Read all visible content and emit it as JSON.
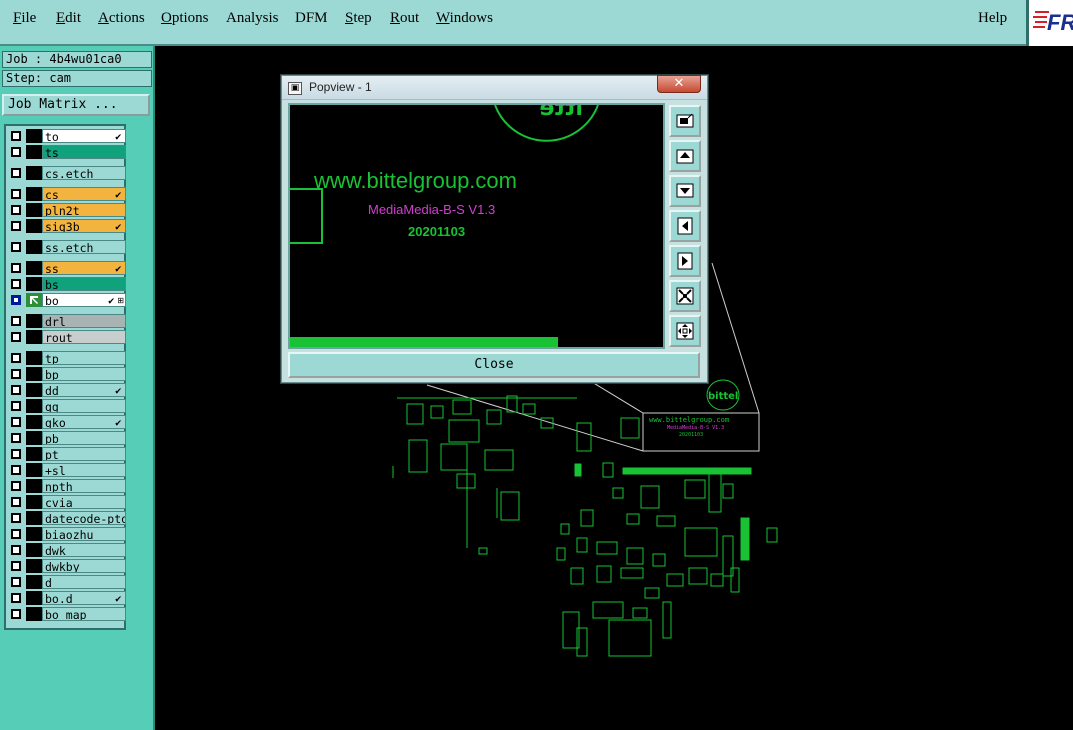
{
  "menubar": {
    "items": [
      {
        "pre": "",
        "u": "F",
        "post": "ile"
      },
      {
        "pre": "",
        "u": "E",
        "post": "dit"
      },
      {
        "pre": "",
        "u": "A",
        "post": "ctions"
      },
      {
        "pre": "",
        "u": "O",
        "post": "ptions"
      },
      {
        "pre": "",
        "u": "",
        "post": "Analysis"
      },
      {
        "pre": "",
        "u": "",
        "post": "DFM"
      },
      {
        "pre": "",
        "u": "S",
        "post": "tep"
      },
      {
        "pre": "",
        "u": "R",
        "post": "out"
      },
      {
        "pre": "",
        "u": "W",
        "post": "indows"
      }
    ],
    "help": "Help",
    "logo_text": "FR"
  },
  "job": {
    "job_line": "Job : 4b4wu01ca0",
    "step_line": "Step: cam",
    "matrix_button": "Job Matrix ..."
  },
  "layers": [
    {
      "name": "to",
      "color": "white",
      "mark": "✔"
    },
    {
      "name": "ts",
      "color": "green",
      "mark": ""
    },
    {
      "name": "cs.etch",
      "color": "default",
      "mark": ""
    },
    {
      "name": "cs",
      "color": "orange",
      "mark": "✔"
    },
    {
      "name": "pln2t",
      "color": "orange",
      "mark": ""
    },
    {
      "name": "sig3b",
      "color": "orange",
      "mark": "✔"
    },
    {
      "name": "ss.etch",
      "color": "default",
      "mark": ""
    },
    {
      "name": "ss",
      "color": "orange",
      "mark": "✔"
    },
    {
      "name": "bs",
      "color": "green",
      "mark": ""
    },
    {
      "name": "bo",
      "color": "white",
      "mark": "✔"
    },
    {
      "name": "drl",
      "color": "grey",
      "mark": ""
    },
    {
      "name": "rout",
      "color": "lightgrey",
      "mark": ""
    },
    {
      "name": "tp",
      "color": "default",
      "mark": ""
    },
    {
      "name": "bp",
      "color": "default",
      "mark": ""
    },
    {
      "name": "dd",
      "color": "default",
      "mark": "✔"
    },
    {
      "name": "gg",
      "color": "default",
      "mark": ""
    },
    {
      "name": "gko",
      "color": "default",
      "mark": "✔"
    },
    {
      "name": "pb",
      "color": "default",
      "mark": ""
    },
    {
      "name": "pt",
      "color": "default",
      "mark": ""
    },
    {
      "name": "+sl",
      "color": "default",
      "mark": ""
    },
    {
      "name": "npth",
      "color": "default",
      "mark": ""
    },
    {
      "name": "cvia",
      "color": "default",
      "mark": ""
    },
    {
      "name": "datecode-pto",
      "color": "default",
      "mark": ""
    },
    {
      "name": "biaozhu",
      "color": "default",
      "mark": ""
    },
    {
      "name": "dwk",
      "color": "default",
      "mark": ""
    },
    {
      "name": "dwkby",
      "color": "default",
      "mark": ""
    },
    {
      "name": "d",
      "color": "default",
      "mark": ""
    },
    {
      "name": "bo.d",
      "color": "default",
      "mark": "✔"
    },
    {
      "name": "bo_map",
      "color": "default",
      "mark": ""
    }
  ],
  "popview": {
    "title": "Popview - 1",
    "close_x": "✕",
    "close_button": "Close",
    "silk_url": "www.bittelgroup.com",
    "silk_model": "MediaMedia-B-S  V1.3",
    "silk_date": "20201103",
    "board_logo": "bittel",
    "tools": [
      "zoom-fit-icon",
      "move-up-icon",
      "move-down-icon",
      "move-left-icon",
      "move-right-icon",
      "zoom-out-icon",
      "pan-icon"
    ]
  },
  "colors": {
    "panel": "#9cd9d5",
    "left_bg": "#56cdb6",
    "silk_green": "#18c234",
    "silk_magenta": "#d33fd3"
  }
}
